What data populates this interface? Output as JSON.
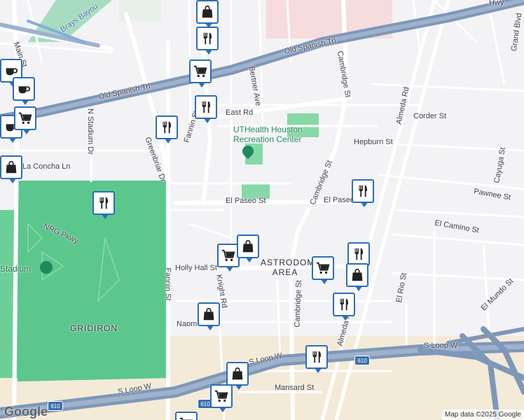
{
  "map": {
    "streets": [
      "Old Spanish Trl",
      "Old Spanish Trl",
      "Cambridge St",
      "Cambridge St",
      "Cambridge St",
      "Almeda Rd",
      "Almeda Rd",
      "Bertner Ave",
      "East Rd",
      "Corder St",
      "Hepburn St",
      "El Paseo St",
      "El Paseo St",
      "El Camino St",
      "Pawnee St",
      "Cayuga St",
      "El Rio St",
      "El Mundo St",
      "Fannin St",
      "Fannin St",
      "Greenbriar Dr",
      "N Stadium Dr",
      "La Concha Ln",
      "NRG Pkwy",
      "Holly Hall St",
      "Knight Rd",
      "Naom",
      "Mansard St",
      "S Loop W",
      "S Loop W",
      "S Loop W",
      "Grand Blvd",
      "Hwy",
      "Brays Bayou",
      "Main St"
    ],
    "places": {
      "recreation_center": "UTHealth Houston Recreation Center",
      "astrodome_area": "ASTRODOME AREA",
      "stadium": "Stadium",
      "gridiron": "GRIDIRON"
    },
    "highway_shields": [
      "610",
      "610",
      "610"
    ],
    "poi_icons": [
      "coffee-icon",
      "coffee-icon",
      "coffee-icon",
      "shopping-cart-icon",
      "shopping-cart-icon",
      "shopping-cart-icon",
      "shopping-cart-icon",
      "shopping-cart-icon",
      "shopping-cart-icon",
      "restaurant-icon",
      "restaurant-icon",
      "restaurant-icon",
      "restaurant-icon",
      "restaurant-icon",
      "restaurant-icon",
      "restaurant-icon",
      "restaurant-icon",
      "shopping-bag-icon",
      "shopping-bag-icon",
      "shopping-bag-icon",
      "shopping-bag-icon",
      "shopping-bag-icon",
      "shopping-bag-icon"
    ],
    "colors": {
      "pin_border": "#2d6db8",
      "park": "#5bc78d",
      "freeway": "#7f97b8",
      "road": "#ffffff",
      "background": "#f3f2f5"
    }
  },
  "footer": {
    "logo": "Google",
    "attribution": "Map data ©2025 Google"
  }
}
